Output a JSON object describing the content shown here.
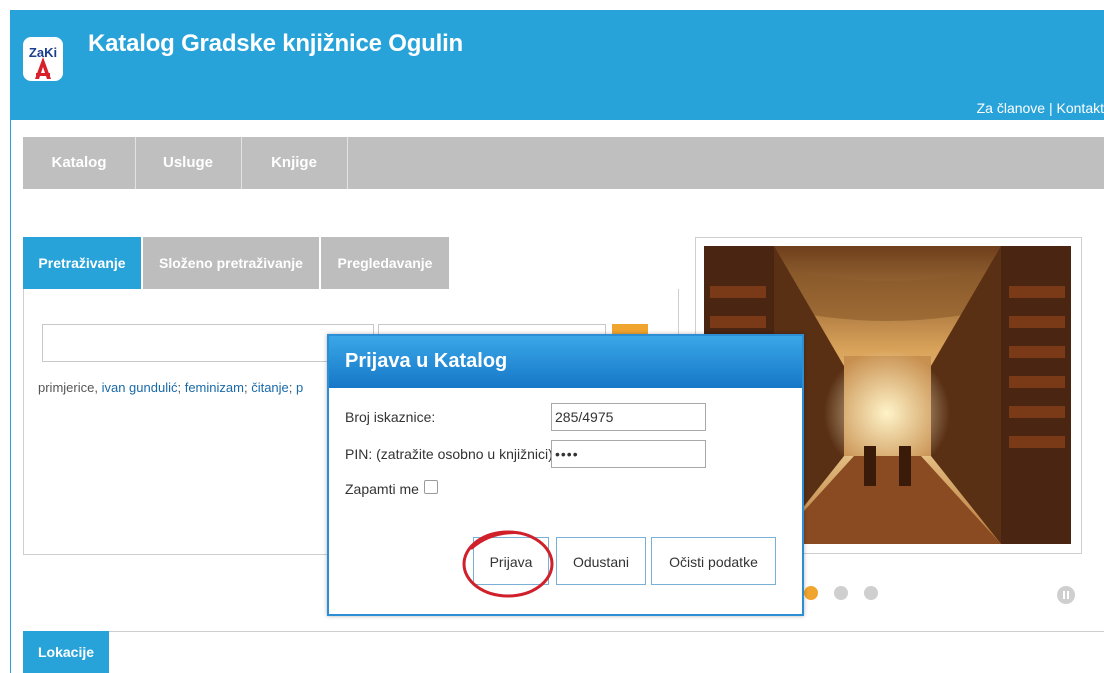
{
  "header": {
    "title": "Katalog Gradske knjižnice Ogulin",
    "logo_text": "ZaKi",
    "links": [
      "Za članove",
      "Kontakt"
    ],
    "separator": " | "
  },
  "nav": {
    "items": [
      "Katalog",
      "Usluge",
      "Knjige"
    ]
  },
  "search": {
    "tabs": [
      "Pretraživanje",
      "Složeno pretraživanje",
      "Pregledavanje"
    ],
    "active_tab": "Pretraživanje",
    "examples_prefix": "primjerice, ",
    "examples": [
      "ivan gundulić",
      "feminizam",
      "čitanje",
      "p"
    ],
    "examples_sep": "; "
  },
  "slider": {
    "dots": 4,
    "active_dot": 1
  },
  "locations": {
    "tab_label": "Lokacije"
  },
  "modal": {
    "title": "Prijava u Katalog",
    "card_label": "Broj iskaznice:",
    "card_value": "285/4975",
    "pin_label": "PIN: (zatražite osobno u knjižnici)",
    "pin_value": "••••",
    "remember_label": "Zapamti me",
    "remember_checked": false,
    "buttons": {
      "login": "Prijava",
      "cancel": "Odustani",
      "clear": "Očisti podatke"
    }
  },
  "colors": {
    "brand_blue": "#28a3da",
    "nav_gray": "#bfbfbf",
    "accent_orange": "#f0a52e",
    "annotation_red": "#d0202a"
  }
}
